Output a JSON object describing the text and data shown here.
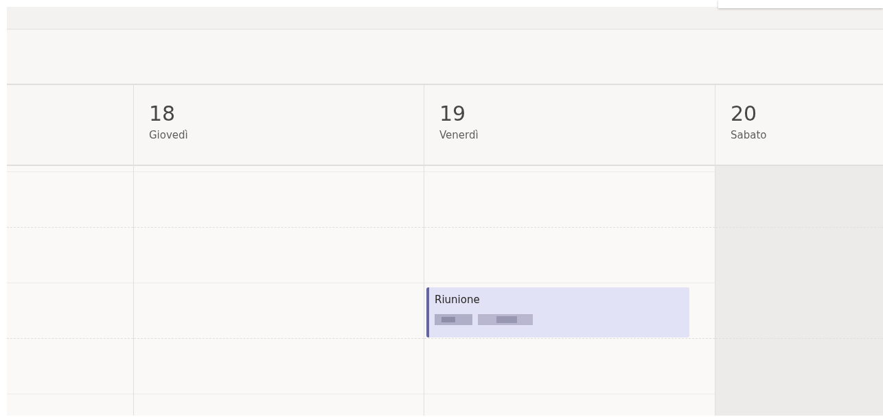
{
  "days": [
    {
      "number": "18",
      "name": "Giovedì",
      "weekend": false
    },
    {
      "number": "19",
      "name": "Venerdì",
      "weekend": false,
      "events": [
        {
          "title": "Riunione"
        }
      ]
    },
    {
      "number": "20",
      "name": "Sabato",
      "weekend": true
    }
  ]
}
